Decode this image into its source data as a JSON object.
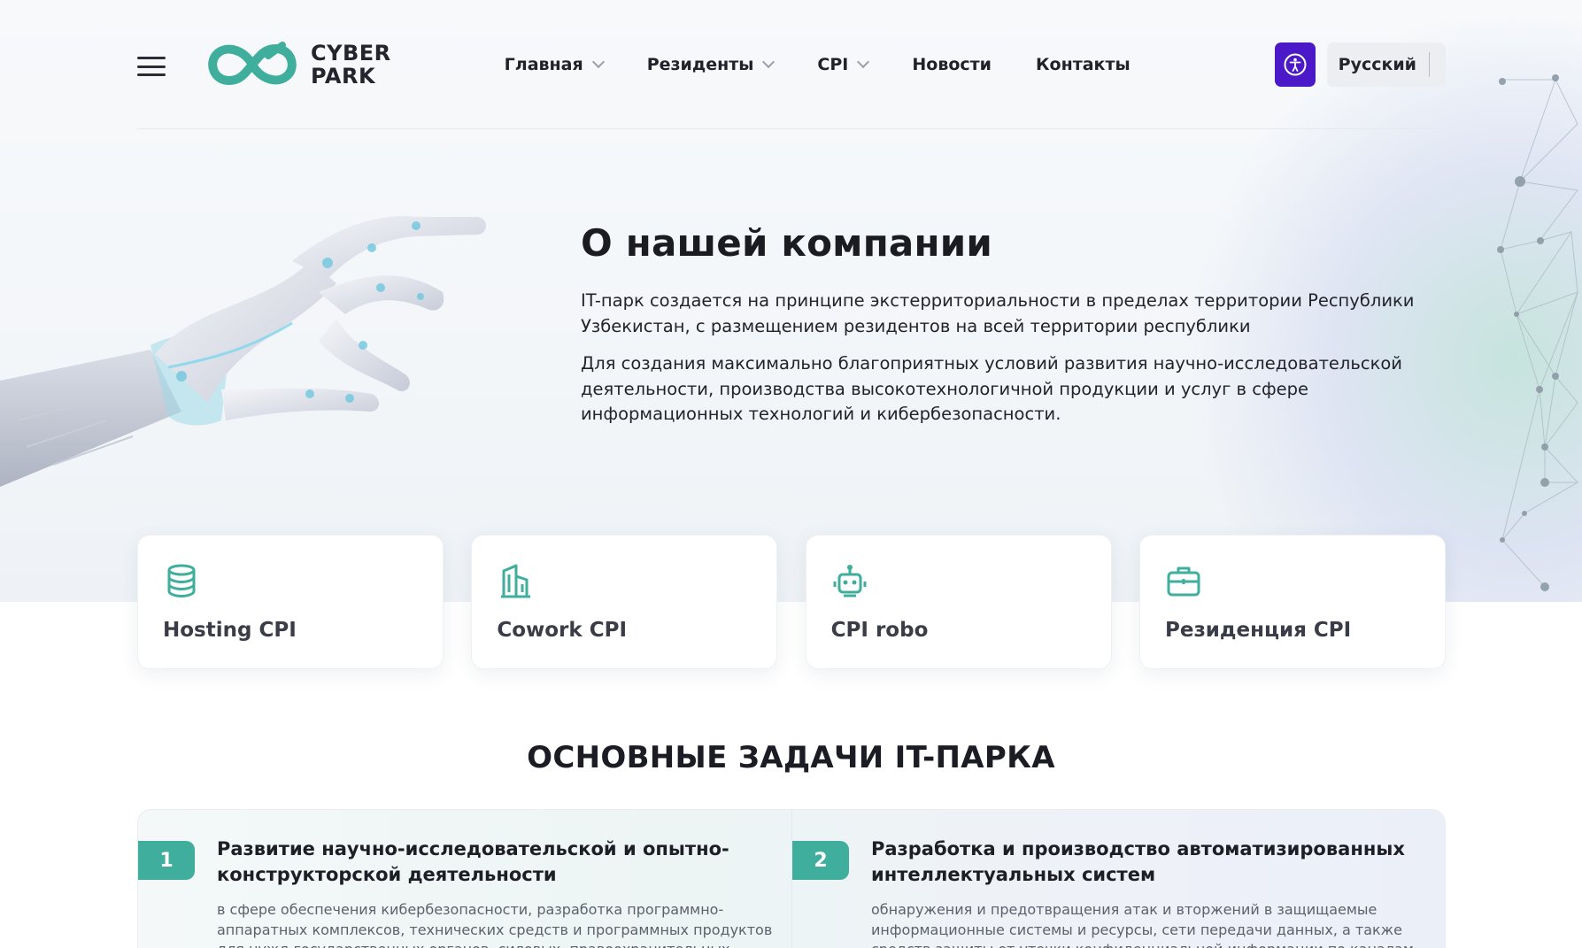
{
  "header": {
    "logo": {
      "line1": "CYBER",
      "line2": "PARK"
    },
    "nav": [
      {
        "label": "Главная",
        "dropdown": true
      },
      {
        "label": "Резиденты",
        "dropdown": true
      },
      {
        "label": "CPI",
        "dropdown": true
      },
      {
        "label": "Новости",
        "dropdown": false
      },
      {
        "label": "Контакты",
        "dropdown": false
      }
    ],
    "language": "Русский"
  },
  "about": {
    "title": "О нашей компании",
    "paragraph1": "IT-парк создается на принципе экстерриториальности в пределах территории Республики Узбекистан, с размещением резидентов на всей территории республики",
    "paragraph2": "Для создания максимально благоприятных условий развития научно-исследовательской деятельности, производства высокотехнологичной продукции и услуг в сфере информационных технологий и кибербезопасности."
  },
  "cards": [
    {
      "label": "Hosting CPI",
      "icon": "database-icon"
    },
    {
      "label": "Cowork CPI",
      "icon": "building-icon"
    },
    {
      "label": "CPI robo",
      "icon": "robot-icon"
    },
    {
      "label": "Резиденция CPI",
      "icon": "briefcase-icon"
    }
  ],
  "tasks": {
    "title": "ОСНОВНЫЕ ЗАДАЧИ IT-ПАРКА",
    "items": [
      {
        "number": "1",
        "title": "Развитие научно-исследовательской и опытно-конструкторской деятельности",
        "text": "в сфере обеспечения кибербезопасности, разработка программно-аппаратных комплексов, технических средств и программных продуктов для нужд государственных органов, силовых, правоохранительных"
      },
      {
        "number": "2",
        "title": "Разработка и производство автоматизированных интеллектуальных систем",
        "text": "обнаружения и предотвращения атак и вторжений в защищаемые информационные системы и ресурсы, сети передачи данных, а также средств защиты от утечки конфиденциальной информации по каналам"
      }
    ]
  },
  "colors": {
    "accent": "#3fae9c",
    "access_button": "#4b19c7",
    "text": "#1d1d24"
  }
}
